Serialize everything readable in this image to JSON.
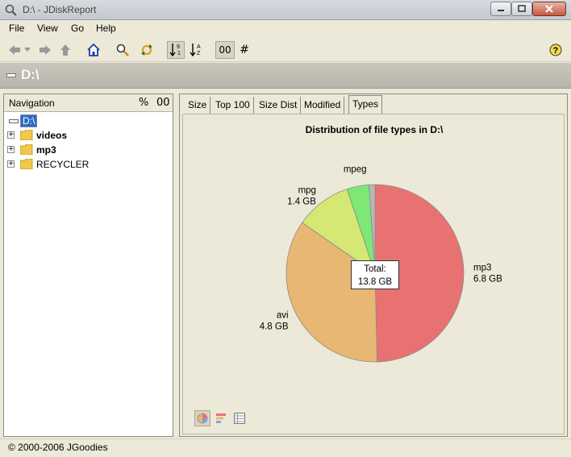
{
  "window": {
    "title": "D:\\ - JDiskReport"
  },
  "menu": {
    "items": [
      {
        "label": "File"
      },
      {
        "label": "View"
      },
      {
        "label": "Go"
      },
      {
        "label": "Help"
      }
    ]
  },
  "toolbar": {
    "icons": [
      "back-icon",
      "back-dropdown-icon",
      "forward-icon",
      "up-icon",
      "home-icon",
      "search-icon",
      "refresh-icon",
      "sort-size-icon",
      "sort-name-icon",
      "oo-toggle",
      "hash-toggle",
      "help-icon"
    ],
    "oo_label": "00",
    "hash_label": "#"
  },
  "path": {
    "title": "D:\\"
  },
  "navigation": {
    "title": "Navigation",
    "percent_label": "%",
    "oo_label": "00",
    "root": "D:\\",
    "items": [
      {
        "label": "videos",
        "bold": true
      },
      {
        "label": "mp3",
        "bold": true
      },
      {
        "label": "RECYCLER",
        "bold": false
      }
    ]
  },
  "tabs": [
    {
      "label": "Size"
    },
    {
      "label": "Top 100"
    },
    {
      "label": "Size Dist"
    },
    {
      "label": "Modified"
    },
    {
      "label": "Types",
      "active": true
    }
  ],
  "chart_data": {
    "type": "pie",
    "title": "Distribution of file types in D:\\",
    "slices": [
      {
        "label": "mp3",
        "value_label": "6.8 GB",
        "value": 6.8,
        "color": "#e87272"
      },
      {
        "label": "avi",
        "value_label": "4.8 GB",
        "value": 4.8,
        "color": "#e9b774"
      },
      {
        "label": "mpg",
        "value_label": "1.4 GB",
        "value": 1.4,
        "color": "#d6e874"
      },
      {
        "label": "mpeg",
        "value_label": "",
        "value": 0.55,
        "color": "#7ee874"
      },
      {
        "label": "",
        "value_label": "",
        "value": 0.15,
        "color": "#b7b7b7"
      }
    ],
    "total_label": "Total:",
    "total_value": "13.8 GB"
  },
  "view_buttons": [
    "pie-chart-icon",
    "bar-chart-icon",
    "table-icon"
  ],
  "status": {
    "copyright": "© 2000-2006 JGoodies"
  }
}
